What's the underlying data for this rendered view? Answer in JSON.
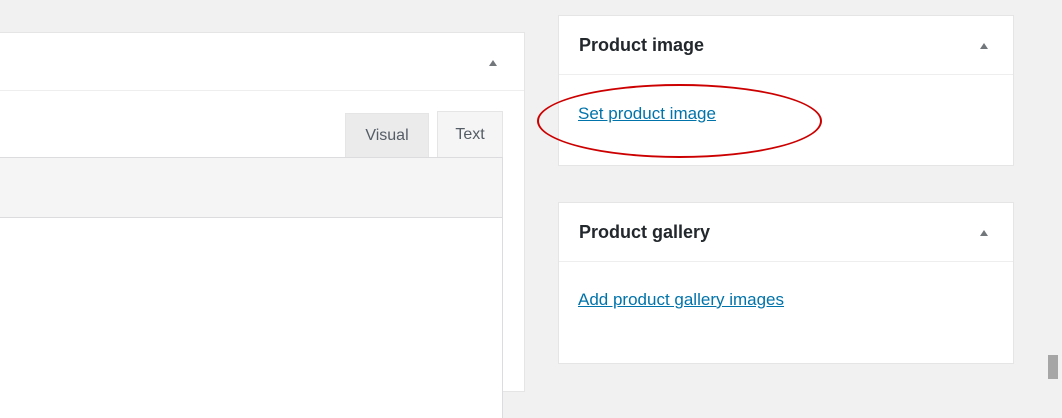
{
  "editor": {
    "tabs": [
      {
        "label": "Visual"
      },
      {
        "label": "Text"
      }
    ]
  },
  "sidebar": {
    "product_image": {
      "title": "Product image",
      "link": "Set product image"
    },
    "product_gallery": {
      "title": "Product gallery",
      "link": "Add product gallery images"
    }
  },
  "icons": {
    "toggle": "triangle-up-icon"
  },
  "colors": {
    "link": "#0073aa",
    "highlight": "#cc0000",
    "background": "#f1f1f1"
  }
}
